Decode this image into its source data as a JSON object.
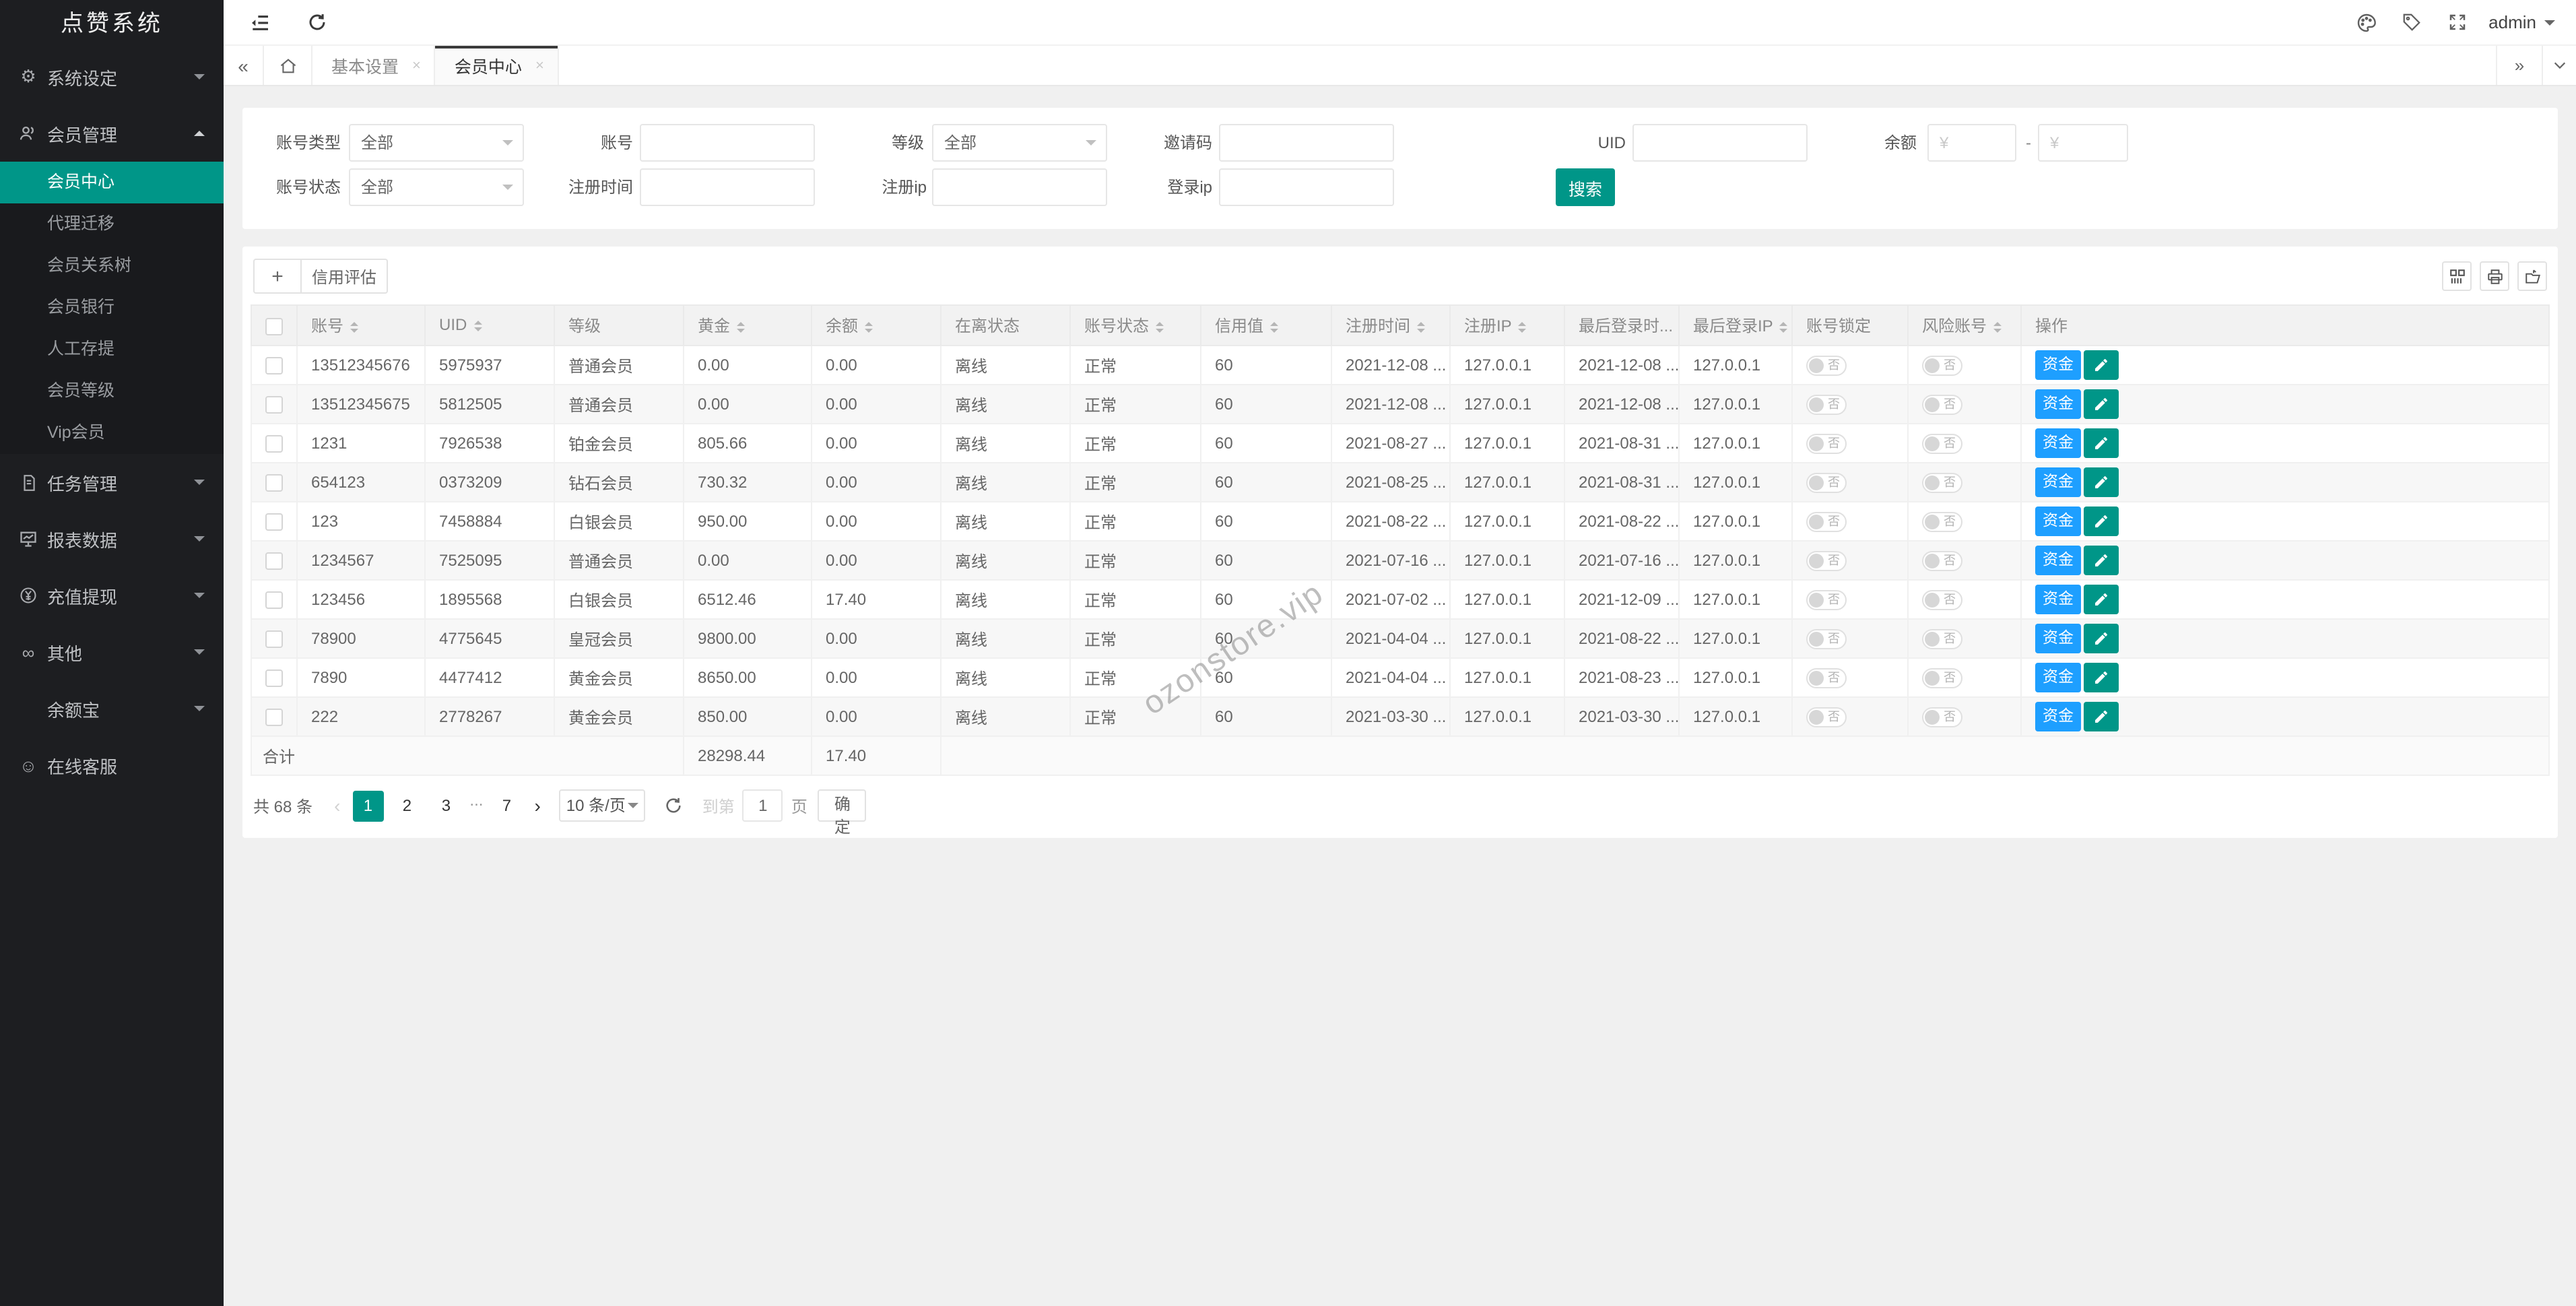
{
  "app": {
    "logo": "点赞系统"
  },
  "sidebar": {
    "items": [
      {
        "id": "system-settings",
        "icon": "gear",
        "label": "系统设定",
        "caret": "down"
      },
      {
        "id": "member-management",
        "icon": "users",
        "label": "会员管理",
        "caret": "up",
        "children": [
          {
            "id": "member-center",
            "label": "会员中心",
            "active": true
          },
          {
            "id": "agent-migration",
            "label": "代理迁移"
          },
          {
            "id": "member-tree",
            "label": "会员关系树"
          },
          {
            "id": "member-bank",
            "label": "会员银行"
          },
          {
            "id": "manual-deposit",
            "label": "人工存提"
          },
          {
            "id": "member-level",
            "label": "会员等级"
          },
          {
            "id": "vip-member",
            "label": "Vip会员"
          }
        ]
      },
      {
        "id": "task-management",
        "icon": "task",
        "label": "任务管理",
        "caret": "down"
      },
      {
        "id": "report-data",
        "icon": "report",
        "label": "报表数据",
        "caret": "down"
      },
      {
        "id": "recharge-withdraw",
        "icon": "yen",
        "label": "充值提现",
        "caret": "down"
      },
      {
        "id": "others",
        "icon": "infinity",
        "label": "其他",
        "caret": "down"
      },
      {
        "id": "yuebao",
        "icon": "",
        "label": "余额宝",
        "caret": "down"
      },
      {
        "id": "online-service",
        "icon": "smiley",
        "label": "在线客服",
        "caret": ""
      }
    ]
  },
  "topbar": {
    "admin_label": "admin"
  },
  "tabbar": {
    "tabs": [
      {
        "label": "基本设置",
        "close": "×",
        "active": false
      },
      {
        "label": "会员中心",
        "close": "×",
        "active": true
      }
    ]
  },
  "search_form": {
    "account_type": {
      "label": "账号类型",
      "value": "全部"
    },
    "account": {
      "label": "账号",
      "value": ""
    },
    "level": {
      "label": "等级",
      "value": "全部"
    },
    "invite_code": {
      "label": "邀请码",
      "value": ""
    },
    "uid": {
      "label": "UID",
      "value": ""
    },
    "balance": {
      "label": "余额",
      "min_placeholder": "¥",
      "max_placeholder": "¥",
      "separator": "-"
    },
    "account_status": {
      "label": "账号状态",
      "value": "全部"
    },
    "reg_time": {
      "label": "注册时间",
      "value": ""
    },
    "reg_ip": {
      "label": "注册ip",
      "value": ""
    },
    "login_ip": {
      "label": "登录ip",
      "value": ""
    },
    "submit_label": "搜索"
  },
  "toolbar": {
    "add_label": "+",
    "credit_label": "信用评估"
  },
  "table": {
    "columns": [
      {
        "label": "账号",
        "sortable": true
      },
      {
        "label": "UID",
        "sortable": true
      },
      {
        "label": "等级",
        "sortable": false
      },
      {
        "label": "黄金",
        "sortable": true
      },
      {
        "label": "余额",
        "sortable": true
      },
      {
        "label": "在离状态",
        "sortable": false
      },
      {
        "label": "账号状态",
        "sortable": true
      },
      {
        "label": "信用值",
        "sortable": true
      },
      {
        "label": "注册时间",
        "sortable": true
      },
      {
        "label": "注册IP",
        "sortable": true
      },
      {
        "label": "最后登录时...",
        "sortable": true
      },
      {
        "label": "最后登录IP",
        "sortable": true
      },
      {
        "label": "账号锁定",
        "sortable": false
      },
      {
        "label": "风险账号",
        "sortable": true
      },
      {
        "label": "操作",
        "sortable": false
      }
    ],
    "toggle_off_label": "否",
    "fund_label": "资金",
    "rows": [
      {
        "account": "13512345676",
        "uid": "5975937",
        "level": "普通会员",
        "gold": "0.00",
        "balance": "0.00",
        "online": "离线",
        "status": "正常",
        "credit": "60",
        "reg_time": "2021-12-08 ...",
        "reg_ip": "127.0.0.1",
        "last_time": "2021-12-08 ...",
        "last_ip": "127.0.0.1"
      },
      {
        "account": "13512345675",
        "uid": "5812505",
        "level": "普通会员",
        "gold": "0.00",
        "balance": "0.00",
        "online": "离线",
        "status": "正常",
        "credit": "60",
        "reg_time": "2021-12-08 ...",
        "reg_ip": "127.0.0.1",
        "last_time": "2021-12-08 ...",
        "last_ip": "127.0.0.1"
      },
      {
        "account": "1231",
        "uid": "7926538",
        "level": "铂金会员",
        "gold": "805.66",
        "balance": "0.00",
        "online": "离线",
        "status": "正常",
        "credit": "60",
        "reg_time": "2021-08-27 ...",
        "reg_ip": "127.0.0.1",
        "last_time": "2021-08-31 ...",
        "last_ip": "127.0.0.1"
      },
      {
        "account": "654123",
        "uid": "0373209",
        "level": "钻石会员",
        "gold": "730.32",
        "balance": "0.00",
        "online": "离线",
        "status": "正常",
        "credit": "60",
        "reg_time": "2021-08-25 ...",
        "reg_ip": "127.0.0.1",
        "last_time": "2021-08-31 ...",
        "last_ip": "127.0.0.1"
      },
      {
        "account": "123",
        "uid": "7458884",
        "level": "白银会员",
        "gold": "950.00",
        "balance": "0.00",
        "online": "离线",
        "status": "正常",
        "credit": "60",
        "reg_time": "2021-08-22 ...",
        "reg_ip": "127.0.0.1",
        "last_time": "2021-08-22 ...",
        "last_ip": "127.0.0.1"
      },
      {
        "account": "1234567",
        "uid": "7525095",
        "level": "普通会员",
        "gold": "0.00",
        "balance": "0.00",
        "online": "离线",
        "status": "正常",
        "credit": "60",
        "reg_time": "2021-07-16 ...",
        "reg_ip": "127.0.0.1",
        "last_time": "2021-07-16 ...",
        "last_ip": "127.0.0.1"
      },
      {
        "account": "123456",
        "uid": "1895568",
        "level": "白银会员",
        "gold": "6512.46",
        "balance": "17.40",
        "online": "离线",
        "status": "正常",
        "credit": "60",
        "reg_time": "2021-07-02 ...",
        "reg_ip": "127.0.0.1",
        "last_time": "2021-12-09 ...",
        "last_ip": "127.0.0.1"
      },
      {
        "account": "78900",
        "uid": "4775645",
        "level": "皇冠会员",
        "gold": "9800.00",
        "balance": "0.00",
        "online": "离线",
        "status": "正常",
        "credit": "60",
        "reg_time": "2021-04-04 ...",
        "reg_ip": "127.0.0.1",
        "last_time": "2021-08-22 ...",
        "last_ip": "127.0.0.1"
      },
      {
        "account": "7890",
        "uid": "4477412",
        "level": "黄金会员",
        "gold": "8650.00",
        "balance": "0.00",
        "online": "离线",
        "status": "正常",
        "credit": "60",
        "reg_time": "2021-04-04 ...",
        "reg_ip": "127.0.0.1",
        "last_time": "2021-08-23 ...",
        "last_ip": "127.0.0.1"
      },
      {
        "account": "222",
        "uid": "2778267",
        "level": "黄金会员",
        "gold": "850.00",
        "balance": "0.00",
        "online": "离线",
        "status": "正常",
        "credit": "60",
        "reg_time": "2021-03-30 ...",
        "reg_ip": "127.0.0.1",
        "last_time": "2021-03-30 ...",
        "last_ip": "127.0.0.1"
      }
    ],
    "summary": {
      "label": "合计",
      "gold_total": "28298.44",
      "balance_total": "17.40"
    }
  },
  "pagination": {
    "total_text": "共 68 条",
    "prev": "‹",
    "next": "›",
    "pages": [
      "1",
      "2",
      "3",
      "...",
      "7"
    ],
    "current": "1",
    "per_page": "10 条/页",
    "jump_prefix": "到第",
    "jump_value": "1",
    "jump_suffix": "页",
    "confirm_label": "确定"
  },
  "watermark": "ozonstore.vip",
  "colors": {
    "accent_teal": "#009688",
    "action_blue": "#1E9FFF",
    "sidebar_bg": "#1d1e21",
    "content_bg": "#f0f0f0"
  }
}
